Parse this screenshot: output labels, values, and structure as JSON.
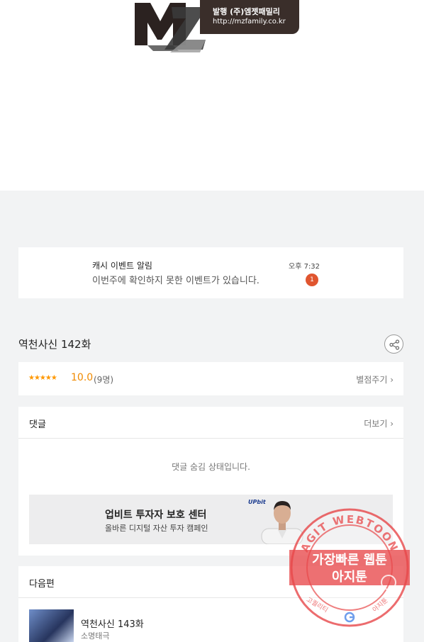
{
  "publisher_logo": {
    "mark": "MZ",
    "publisher": "발행 (주)엠젯패밀리",
    "url": "http://mzfamily.co.kr"
  },
  "notification": {
    "title": "캐시 이벤트 알림",
    "message": "이번주에 확인하지 못한 이벤트가 있습니다.",
    "time": "오후 7:32",
    "badge_count": "1"
  },
  "episode": {
    "title": "역천사신 142화"
  },
  "rating": {
    "stars": "★★★★★",
    "score": "10.0",
    "count": "(9명)",
    "rate_link": "별점주기 ›"
  },
  "comments": {
    "title": "댓글",
    "more_link": "더보기 ›",
    "hidden_message": "댓글 숨김 상태입니다."
  },
  "ad": {
    "logo": "UPbit",
    "title": "업비트 투자자 보호 센터",
    "subtitle": "올바른 디지털 자산 투자 캠페인"
  },
  "next": {
    "section_title": "다음편",
    "episode_title": "역천사신 143화",
    "author": "소명태극"
  },
  "watermark": {
    "ring_text": "AGIT WEBTOON",
    "line1": "가장빠른 웹툰",
    "line2": "아지툰",
    "bottom_left": "고퀄리티",
    "bottom_right": "아지툰",
    "color": "#e8484a"
  }
}
